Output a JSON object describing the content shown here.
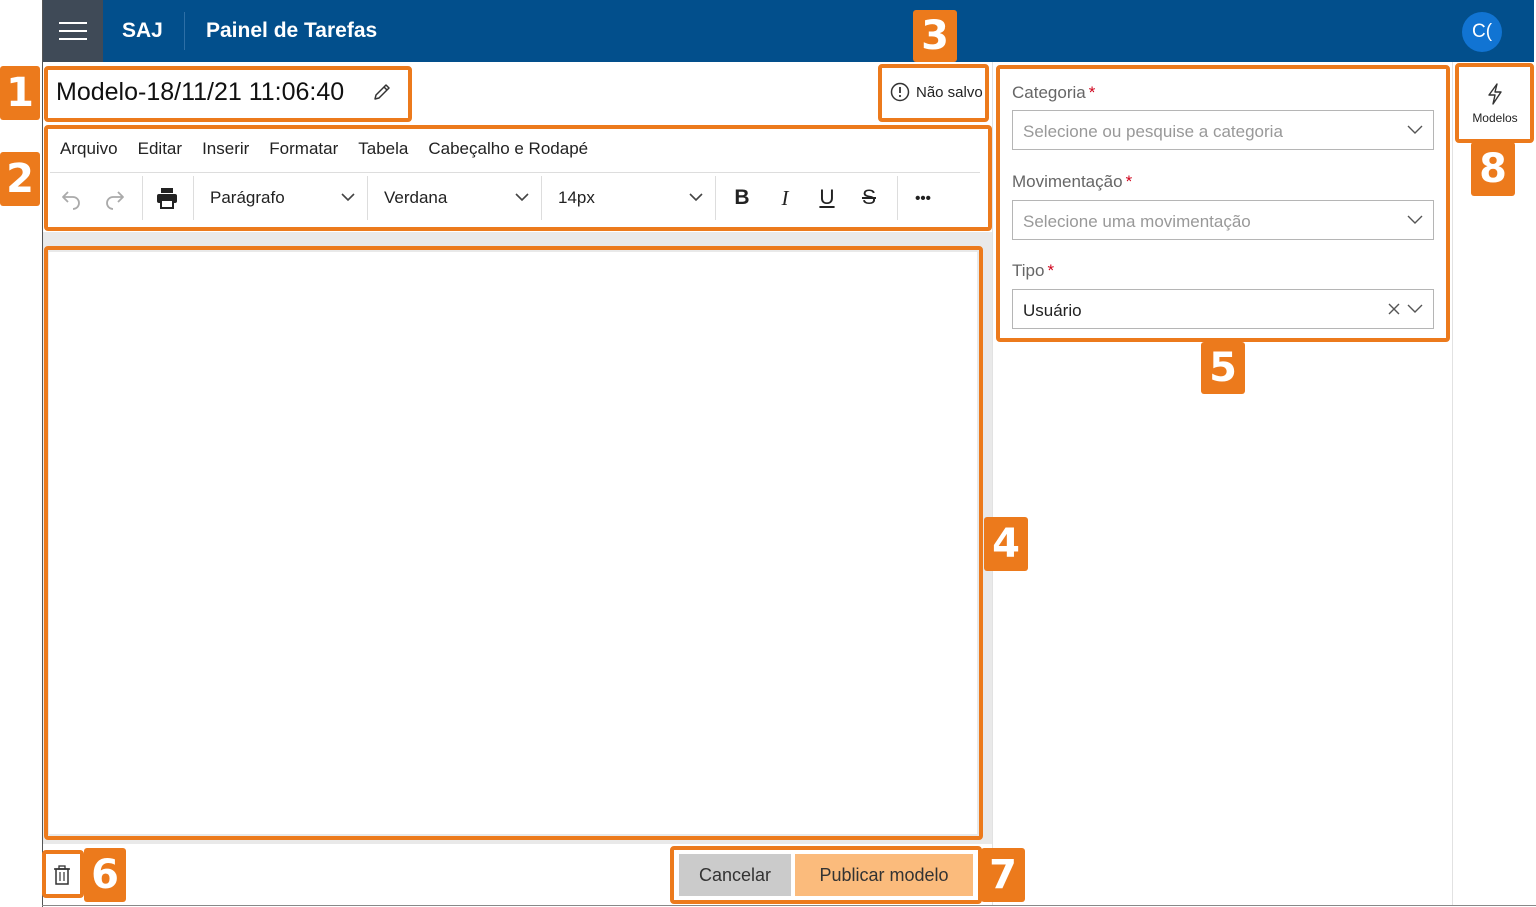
{
  "header": {
    "app_name": "SAJ",
    "page_title": "Painel de Tarefas",
    "avatar_initials": "C(",
    "menu_icon": "hamburger-menu-icon"
  },
  "model": {
    "name": "Modelo-18/11/21 11:06:40",
    "edit_icon": "pencil-icon"
  },
  "status": {
    "text": "Não salvo",
    "icon": "alert-circle-icon"
  },
  "editor": {
    "menu": [
      "Arquivo",
      "Editar",
      "Inserir",
      "Formatar",
      "Tabela",
      "Cabeçalho e Rodapé"
    ],
    "block_format": "Parágrafo",
    "font_family": "Verdana",
    "font_size": "14px",
    "format_buttons": {
      "bold": "B",
      "italic": "I",
      "underline": "U",
      "strikethrough": "S"
    },
    "more_label": "•••"
  },
  "form": {
    "categoria": {
      "label": "Categoria",
      "required": "*",
      "placeholder": "Selecione ou pesquise a categoria"
    },
    "movimentacao": {
      "label": "Movimentação",
      "required": "*",
      "placeholder": "Selecione uma movimentação"
    },
    "tipo": {
      "label": "Tipo",
      "required": "*",
      "value": "Usuário"
    }
  },
  "side_rail": {
    "models_label": "Modelos",
    "models_icon": "lightning-icon"
  },
  "footer": {
    "cancel_label": "Cancelar",
    "publish_label": "Publicar modelo",
    "delete_icon": "trash-icon"
  },
  "callouts": {
    "c1": "1",
    "c2": "2",
    "c3": "3",
    "c4": "4",
    "c5": "5",
    "c6": "6",
    "c7": "7",
    "c8": "8"
  },
  "colors": {
    "header": "#024f8c",
    "accent": "#ec7a1c",
    "avatar": "#1174d3",
    "publish": "#fbbb7c"
  }
}
